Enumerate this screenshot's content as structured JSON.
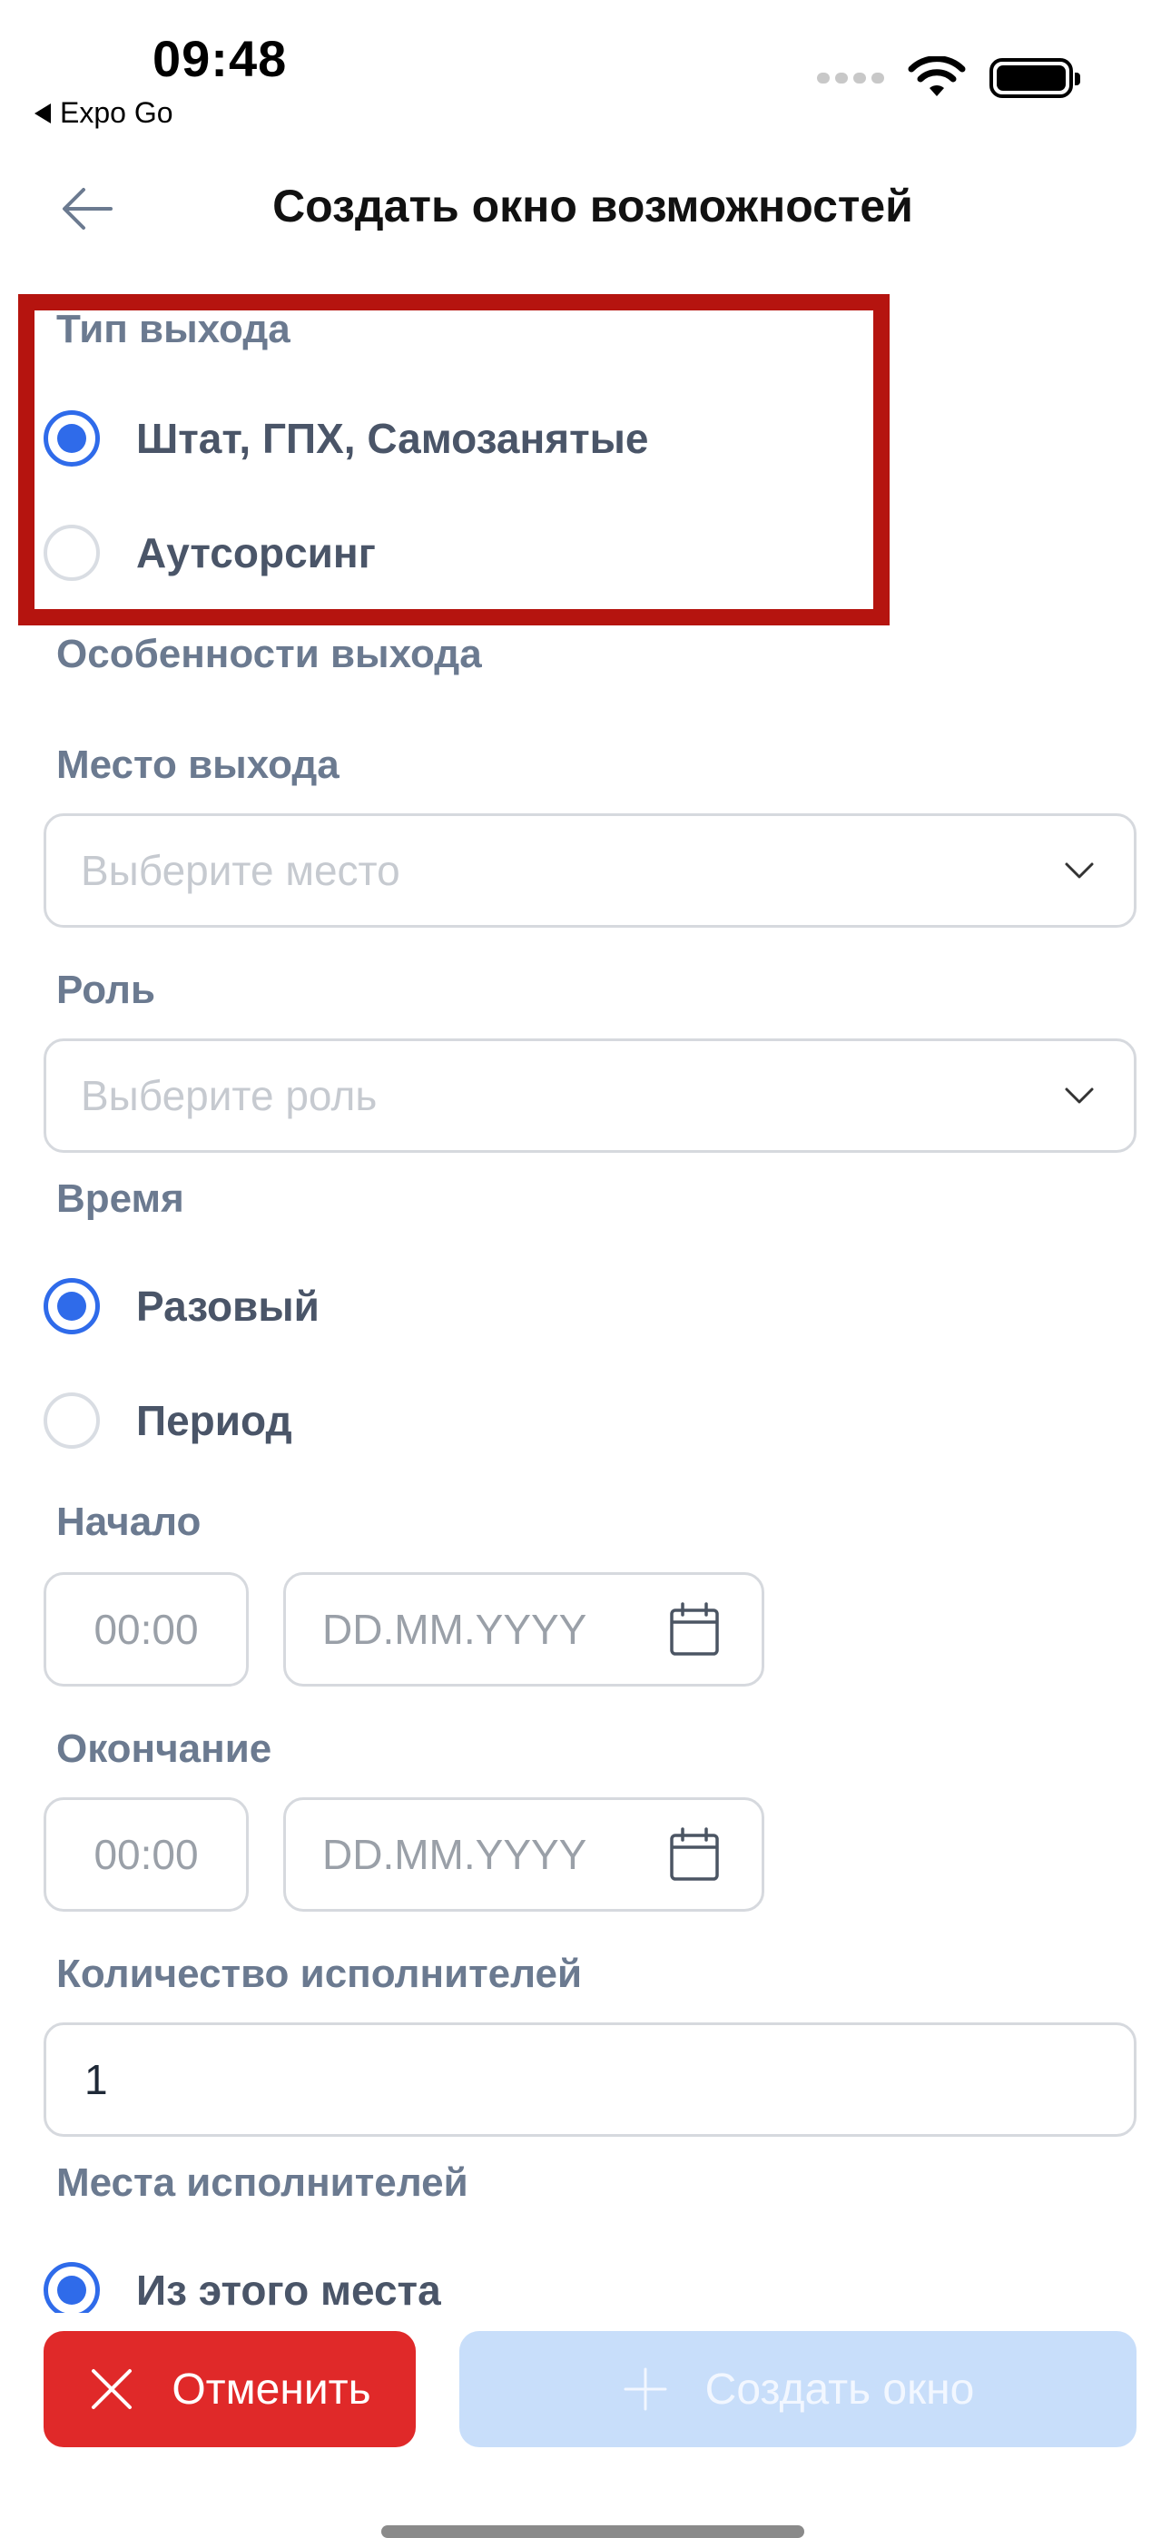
{
  "status_bar": {
    "time": "09:48",
    "back_app": "Expo Go"
  },
  "header": {
    "title": "Создать окно возможностей"
  },
  "exit_type": {
    "label": "Тип выхода",
    "options": [
      {
        "label": "Штат, ГПХ, Самозанятые",
        "selected": true
      },
      {
        "label": "Аутсорсинг",
        "selected": false
      }
    ]
  },
  "features": {
    "label": "Особенности выхода"
  },
  "place": {
    "label": "Место выхода",
    "placeholder": "Выберите место"
  },
  "role": {
    "label": "Роль",
    "placeholder": "Выберите роль"
  },
  "time": {
    "label": "Время",
    "options": [
      {
        "label": "Разовый",
        "selected": true
      },
      {
        "label": "Период",
        "selected": false
      }
    ]
  },
  "start": {
    "label": "Начало",
    "time_placeholder": "00:00",
    "date_placeholder": "DD.MM.YYYY"
  },
  "end": {
    "label": "Окончание",
    "time_placeholder": "00:00",
    "date_placeholder": "DD.MM.YYYY"
  },
  "performers_count": {
    "label": "Количество исполнителей",
    "value": "1"
  },
  "performers_places": {
    "label": "Места исполнителей",
    "options": [
      {
        "label": "Из этого места",
        "selected": true
      }
    ]
  },
  "actions": {
    "cancel_label": "Отменить",
    "create_label": "Создать окно"
  },
  "colors": {
    "accent": "#2f6bea",
    "danger": "#e02929",
    "disabled": "#c8defa",
    "highlight": "#b5140f"
  }
}
